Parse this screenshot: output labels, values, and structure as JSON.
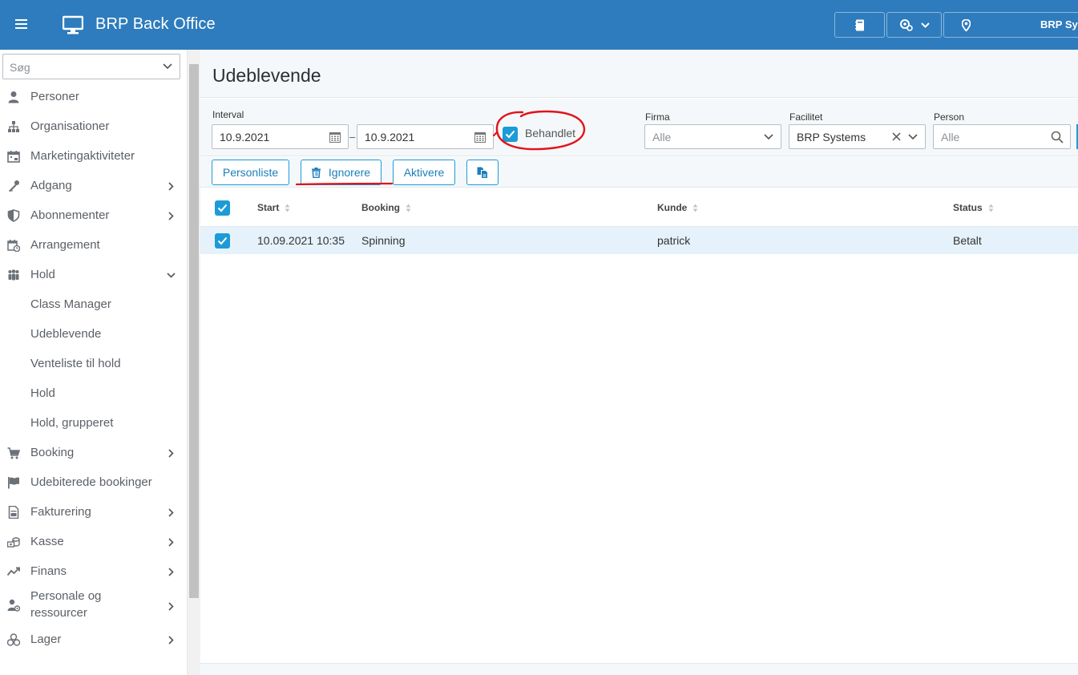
{
  "header": {
    "title": "BRP Back Office",
    "user_label": "BRP Systems"
  },
  "sidebar": {
    "search_placeholder": "Søg",
    "items": [
      {
        "label": "Personer",
        "icon": "person-icon"
      },
      {
        "label": "Organisationer",
        "icon": "sitemap-icon"
      },
      {
        "label": "Marketingaktiviteter",
        "icon": "calendar-icon"
      },
      {
        "label": "Adgang",
        "icon": "key-icon"
      },
      {
        "label": "Abonnementer",
        "icon": "shield-icon"
      },
      {
        "label": "Arrangement",
        "icon": "calendar-clock-icon"
      },
      {
        "label": "Hold",
        "icon": "group-icon"
      },
      {
        "label": "Class Manager"
      },
      {
        "label": "Udeblevende"
      },
      {
        "label": "Venteliste til hold"
      },
      {
        "label": "Hold"
      },
      {
        "label": "Hold, grupperet"
      },
      {
        "label": "Booking",
        "icon": "cart-icon"
      },
      {
        "label": "Udebiterede bookinger",
        "icon": "flag-icon"
      },
      {
        "label": "Fakturering",
        "icon": "invoice-icon"
      },
      {
        "label": "Kasse",
        "icon": "cash-icon"
      },
      {
        "label": "Finans",
        "icon": "chart-line-icon"
      },
      {
        "label_line1": "Personale og",
        "label_line2": "ressourcer",
        "icon": "staff-icon"
      },
      {
        "label": "Lager",
        "icon": "boxes-icon"
      }
    ]
  },
  "page": {
    "title": "Udeblevende"
  },
  "filters": {
    "interval_label": "Interval",
    "date_from": "10.9.2021",
    "date_to": "10.9.2021",
    "dash": "–",
    "behandlet_label": "Behandlet",
    "firma_label": "Firma",
    "firma_placeholder": "Alle",
    "facilitet_label": "Facilitet",
    "facilitet_value": "BRP Systems",
    "person_label": "Person",
    "person_placeholder": "Alle"
  },
  "toolbar": {
    "personliste": "Personliste",
    "ignorere": "Ignorere",
    "aktivere": "Aktivere"
  },
  "table": {
    "columns": [
      "Start",
      "Booking",
      "Kunde",
      "Status"
    ],
    "rows": [
      {
        "start": "10.09.2021 10:35",
        "booking": "Spinning",
        "kunde": "patrick",
        "status": "Betalt"
      }
    ]
  },
  "colors": {
    "header_bg": "#2e7cbd",
    "accent": "#1d9bd7",
    "row_selected": "#e6f2fb",
    "annotation_red": "#e3121b"
  }
}
